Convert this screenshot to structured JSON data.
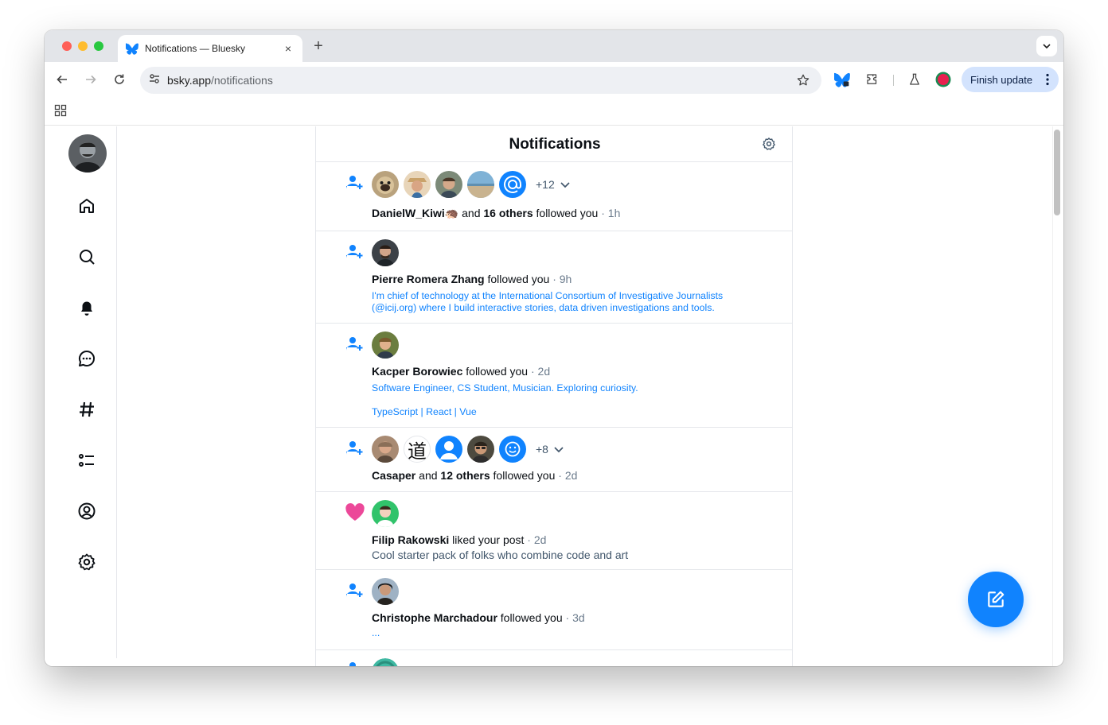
{
  "browser": {
    "tab_title": "Notifications — Bluesky",
    "new_tab_symbol": "+",
    "close_symbol": "×",
    "url_host": "bsky.app",
    "url_path": "/notifications",
    "finish_update_label": "Finish update",
    "icons": [
      "back-arrow-icon",
      "forward-arrow-icon",
      "reload-icon",
      "site-info-icon",
      "star-icon",
      "bluesky-extension-icon",
      "puzzle-extension-icon",
      "labs-flask-icon",
      "profile-icon",
      "kebab-menu-icon",
      "apps-grid-icon"
    ]
  },
  "sidebar": {
    "items": [
      {
        "name": "home",
        "icon": "home-icon"
      },
      {
        "name": "search",
        "icon": "search-icon"
      },
      {
        "name": "notifications",
        "icon": "bell-icon"
      },
      {
        "name": "chat",
        "icon": "chat-icon"
      },
      {
        "name": "feeds",
        "icon": "hashtag-icon"
      },
      {
        "name": "lists",
        "icon": "list-icon"
      },
      {
        "name": "profile",
        "icon": "profile-circle-icon"
      },
      {
        "name": "settings",
        "icon": "gear-icon"
      }
    ]
  },
  "feed": {
    "title": "Notifications",
    "notifications": [
      {
        "type": "follow",
        "more": "+12",
        "actor": "DanielW_Kiwi",
        "actor_emoji": "🦔",
        "and": " and ",
        "others": "16 others",
        "action": " followed you",
        "time": " · 1h"
      },
      {
        "type": "follow",
        "actor": "Pierre Romera Zhang",
        "action": " followed you",
        "time": " · 9h",
        "bio_line1": "I'm chief of technology at the International Consortium of Investigative Journalists",
        "bio_line2": "(@icij.org) where I build interactive stories, data driven investigations and tools."
      },
      {
        "type": "follow",
        "actor": "Kacper Borowiec",
        "action": " followed you",
        "time": " · 2d",
        "bio_line1": "Software Engineer, CS Student, Musician. Exploring curiosity.",
        "bio_line2": "TypeScript | React | Vue"
      },
      {
        "type": "follow",
        "more": "+8",
        "actor": "Casaper",
        "and": " and ",
        "others": "12 others",
        "action": " followed you",
        "time": " · 2d",
        "avatar_glyph": "道"
      },
      {
        "type": "like",
        "actor": "Filip Rakowski",
        "action": " liked your post",
        "time": " · 2d",
        "snippet": "Cool starter pack of folks who combine code and art"
      },
      {
        "type": "follow",
        "actor": "Christophe Marchadour",
        "action": " followed you",
        "time": " · 3d",
        "bio_line1": "..."
      }
    ]
  },
  "colors": {
    "accent": "#1083fe",
    "like": "#ec4899",
    "text": "#0b0f14",
    "muted": "#6b7b8c"
  }
}
